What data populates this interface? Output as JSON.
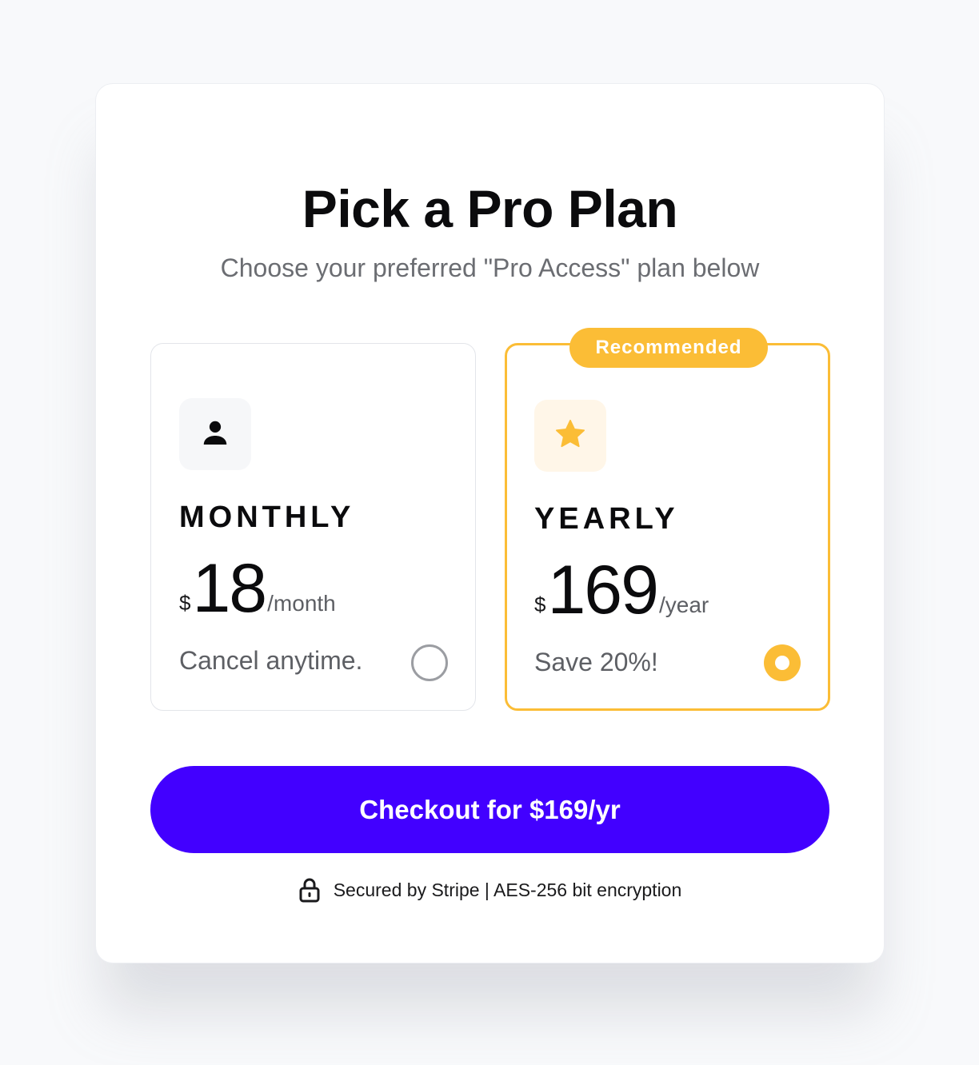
{
  "header": {
    "title": "Pick a Pro Plan",
    "subtitle": "Choose your preferred \"Pro Access\" plan below"
  },
  "plans": [
    {
      "id": "monthly",
      "icon": "user-icon",
      "name": "MONTHLY",
      "currency": "$",
      "amount": "18",
      "period": "/month",
      "note": "Cancel anytime.",
      "selected": false
    },
    {
      "id": "yearly",
      "icon": "star-icon",
      "badge": "Recommended",
      "name": "YEARLY",
      "currency": "$",
      "amount": "169",
      "period": "/year",
      "note": "Save 20%!",
      "selected": true
    }
  ],
  "checkout": {
    "label": "Checkout for $169/yr"
  },
  "footer": {
    "icon": "lock-icon",
    "secure_text": "Secured by Stripe | AES-256 bit encryption"
  },
  "colors": {
    "accent": "#4200ff",
    "highlight": "#fbbd36",
    "background": "#f8f9fb"
  }
}
